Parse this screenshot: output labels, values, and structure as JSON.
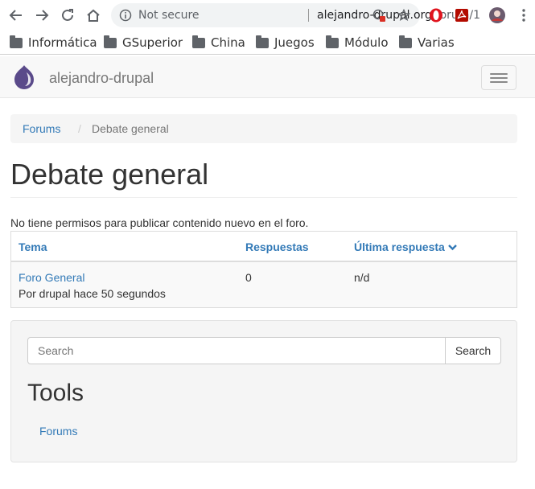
{
  "browser": {
    "security_label": "Not secure",
    "url_host": "alejandro-drupal.org",
    "url_path": "/forum/1"
  },
  "bookmarks": [
    {
      "label": "Informática"
    },
    {
      "label": "GSuperior"
    },
    {
      "label": "China"
    },
    {
      "label": "Juegos"
    },
    {
      "label": "Módulo"
    },
    {
      "label": "Varias"
    }
  ],
  "site": {
    "name": "alejandro-drupal"
  },
  "breadcrumb": {
    "link": "Forums",
    "separator": "/",
    "current": "Debate general"
  },
  "page": {
    "title": "Debate general",
    "notice": "No tiene permisos para publicar contenido nuevo en el foro."
  },
  "forum_table": {
    "headers": {
      "topic": "Tema",
      "replies": "Respuestas",
      "last_reply": "Última respuesta"
    },
    "rows": [
      {
        "topic": "Foro General",
        "byline": "Por drupal hace 50 segundos",
        "replies": "0",
        "last_reply": "n/d"
      }
    ]
  },
  "sidebar": {
    "search_placeholder": "Search",
    "search_button": "Search",
    "tools_title": "Tools",
    "tools_link": "Forums"
  },
  "colors": {
    "link": "#337ab7",
    "drupal_logo": "#5a4a8a",
    "opera_red": "#e0141e",
    "pdf_red": "#b30b00"
  }
}
